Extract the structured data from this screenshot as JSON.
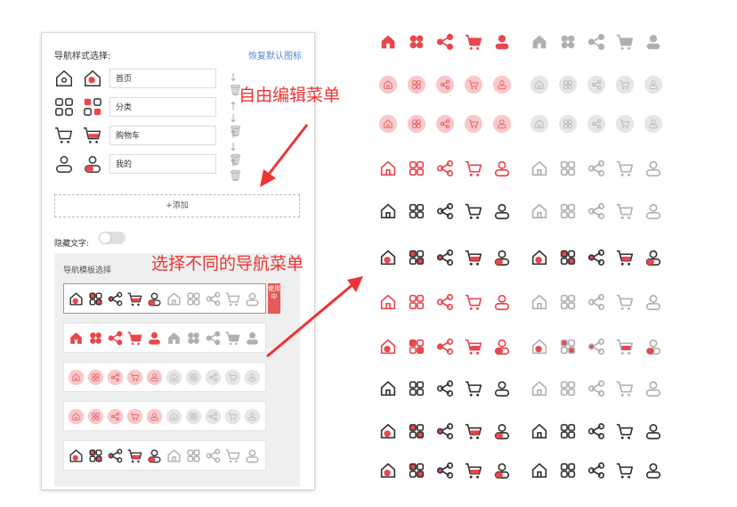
{
  "panel": {
    "nav_style_label": "导航样式选择:",
    "reset_label": "恢复默认图标",
    "nav_items": [
      {
        "icon": "home-icon",
        "label": "首页",
        "actions": "↓ 🗑"
      },
      {
        "icon": "category-icon",
        "label": "分类",
        "actions": "↑ ↓ 🗑"
      },
      {
        "icon": "cart-icon",
        "label": "购物车",
        "actions": "↑ ↓ 🗑"
      },
      {
        "icon": "user-icon",
        "label": "我的",
        "actions": "↑ 🗑"
      }
    ],
    "add_label": "+添加",
    "hide_text_label": "隐藏文字:",
    "hide_text_on": false,
    "template_title": "导航模板选择",
    "active_badge": "使用中"
  },
  "annotations": {
    "edit_menu": "自由编辑菜单",
    "choose_menu": "选择不同的导航菜单"
  },
  "colors": {
    "accent": "#e8474c",
    "accent_light": "#f7c9cb",
    "gray": "#b0b0b0",
    "dark": "#333333",
    "link": "#4a8bd6"
  }
}
